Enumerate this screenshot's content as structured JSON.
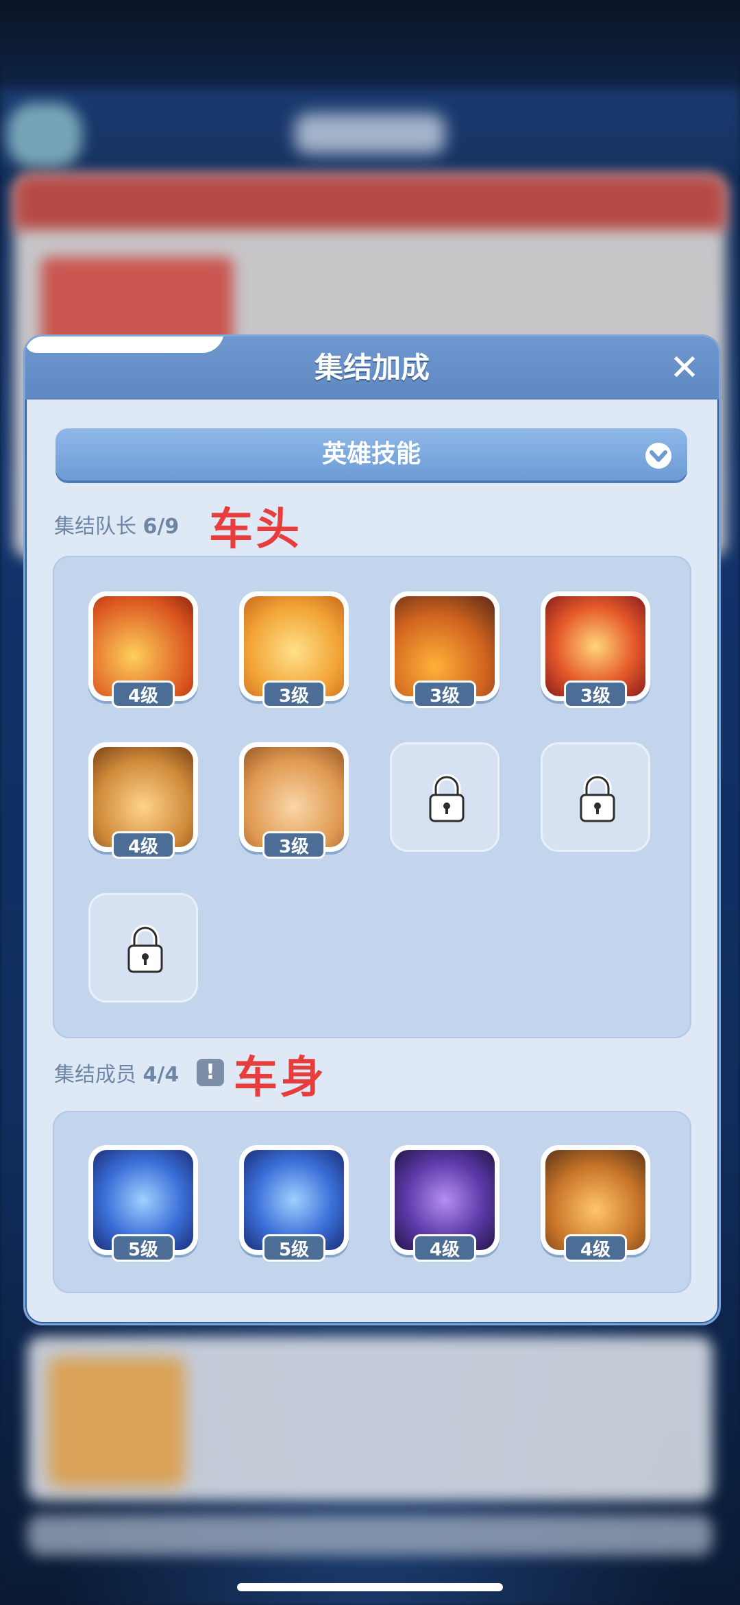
{
  "modal": {
    "title": "集结加成",
    "close_glyph": "✕",
    "dropdown_label": "英雄技能"
  },
  "leader_section": {
    "label": "集结队长",
    "count": "6/9",
    "annotation": "车头",
    "skills": [
      {
        "level": "4级",
        "icon": "armor-sword-icon"
      },
      {
        "level": "3级",
        "icon": "golden-shield-icon"
      },
      {
        "level": "3级",
        "icon": "flaming-gear-icon"
      },
      {
        "level": "3级",
        "icon": "fire-warrior-icon"
      },
      {
        "level": "4级",
        "icon": "bread-cart-icon"
      },
      {
        "level": "3级",
        "icon": "battle-axe-icon"
      }
    ],
    "locked_slots": 3
  },
  "member_section": {
    "label": "集结成员",
    "count": "4/4",
    "annotation": "车身",
    "info_glyph": "!",
    "skills": [
      {
        "level": "5级",
        "icon": "lightning-knight-icon"
      },
      {
        "level": "5级",
        "icon": "lightning-knight-icon"
      },
      {
        "level": "4级",
        "icon": "shadow-mage-icon"
      },
      {
        "level": "4级",
        "icon": "supply-cart-icon"
      }
    ]
  },
  "colors": {
    "accent": "#6f98cf",
    "annotation": "#e73d3d",
    "level_badge": "#4c6d95"
  }
}
